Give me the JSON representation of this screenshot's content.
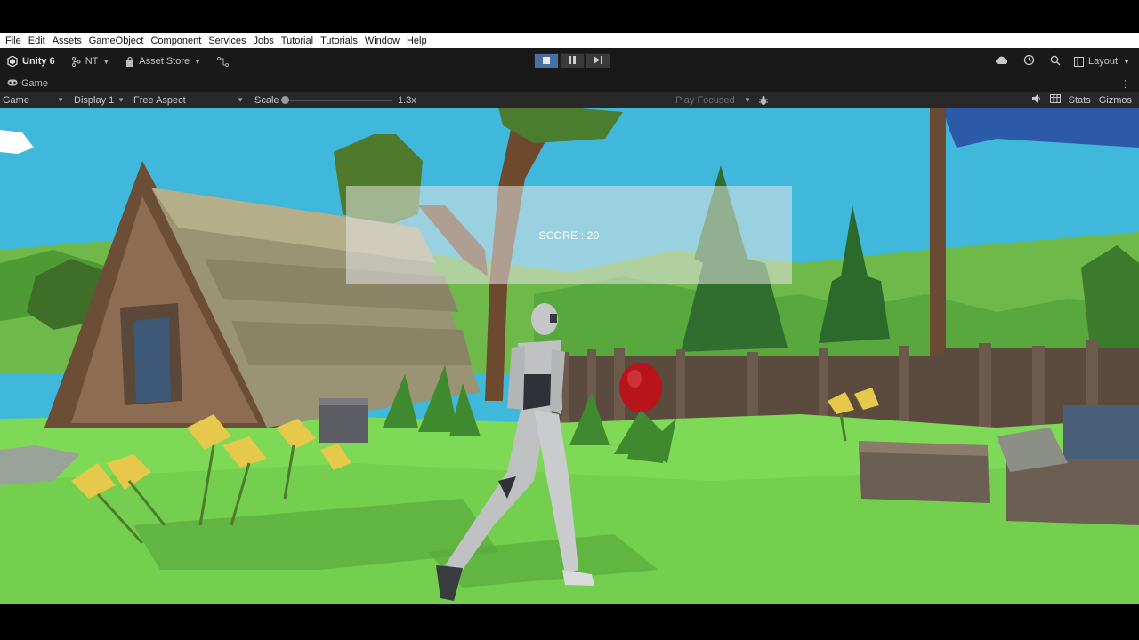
{
  "menu": [
    "File",
    "Edit",
    "Assets",
    "GameObject",
    "Component",
    "Services",
    "Jobs",
    "Tutorial",
    "Tutorials",
    "Window",
    "Help"
  ],
  "toolbar": {
    "unity_label": "Unity 6",
    "account_label": "NT",
    "asset_store_label": "Asset Store",
    "layout_label": "Layout",
    "play_state": "playing"
  },
  "tab": {
    "title": "Game"
  },
  "game_options": {
    "mode": "Game",
    "display": "Display 1",
    "aspect": "Free Aspect",
    "scale_label": "Scale",
    "scale_value": "1.3x",
    "scale_level": 0.0,
    "play_focused": "Play Focused",
    "stats_label": "Stats",
    "gizmos_label": "Gizmos"
  },
  "hud": {
    "score_text": "SCORE : 20"
  },
  "colors": {
    "sky": "#3fb8dc",
    "grass": "#7ed957",
    "play_active": "#4a6fa5",
    "toolbar_bg": "#191919",
    "options_bg": "#282828"
  },
  "icons": [
    "unity-logo-icon",
    "lock-bag-icon",
    "branch-icon",
    "stop-icon",
    "pause-icon",
    "step-icon",
    "cloud-icon",
    "history-icon",
    "search-icon",
    "layout-icon",
    "game-controller-icon",
    "kebab-menu-icon",
    "bug-icon",
    "speaker-icon",
    "grid-icon"
  ]
}
